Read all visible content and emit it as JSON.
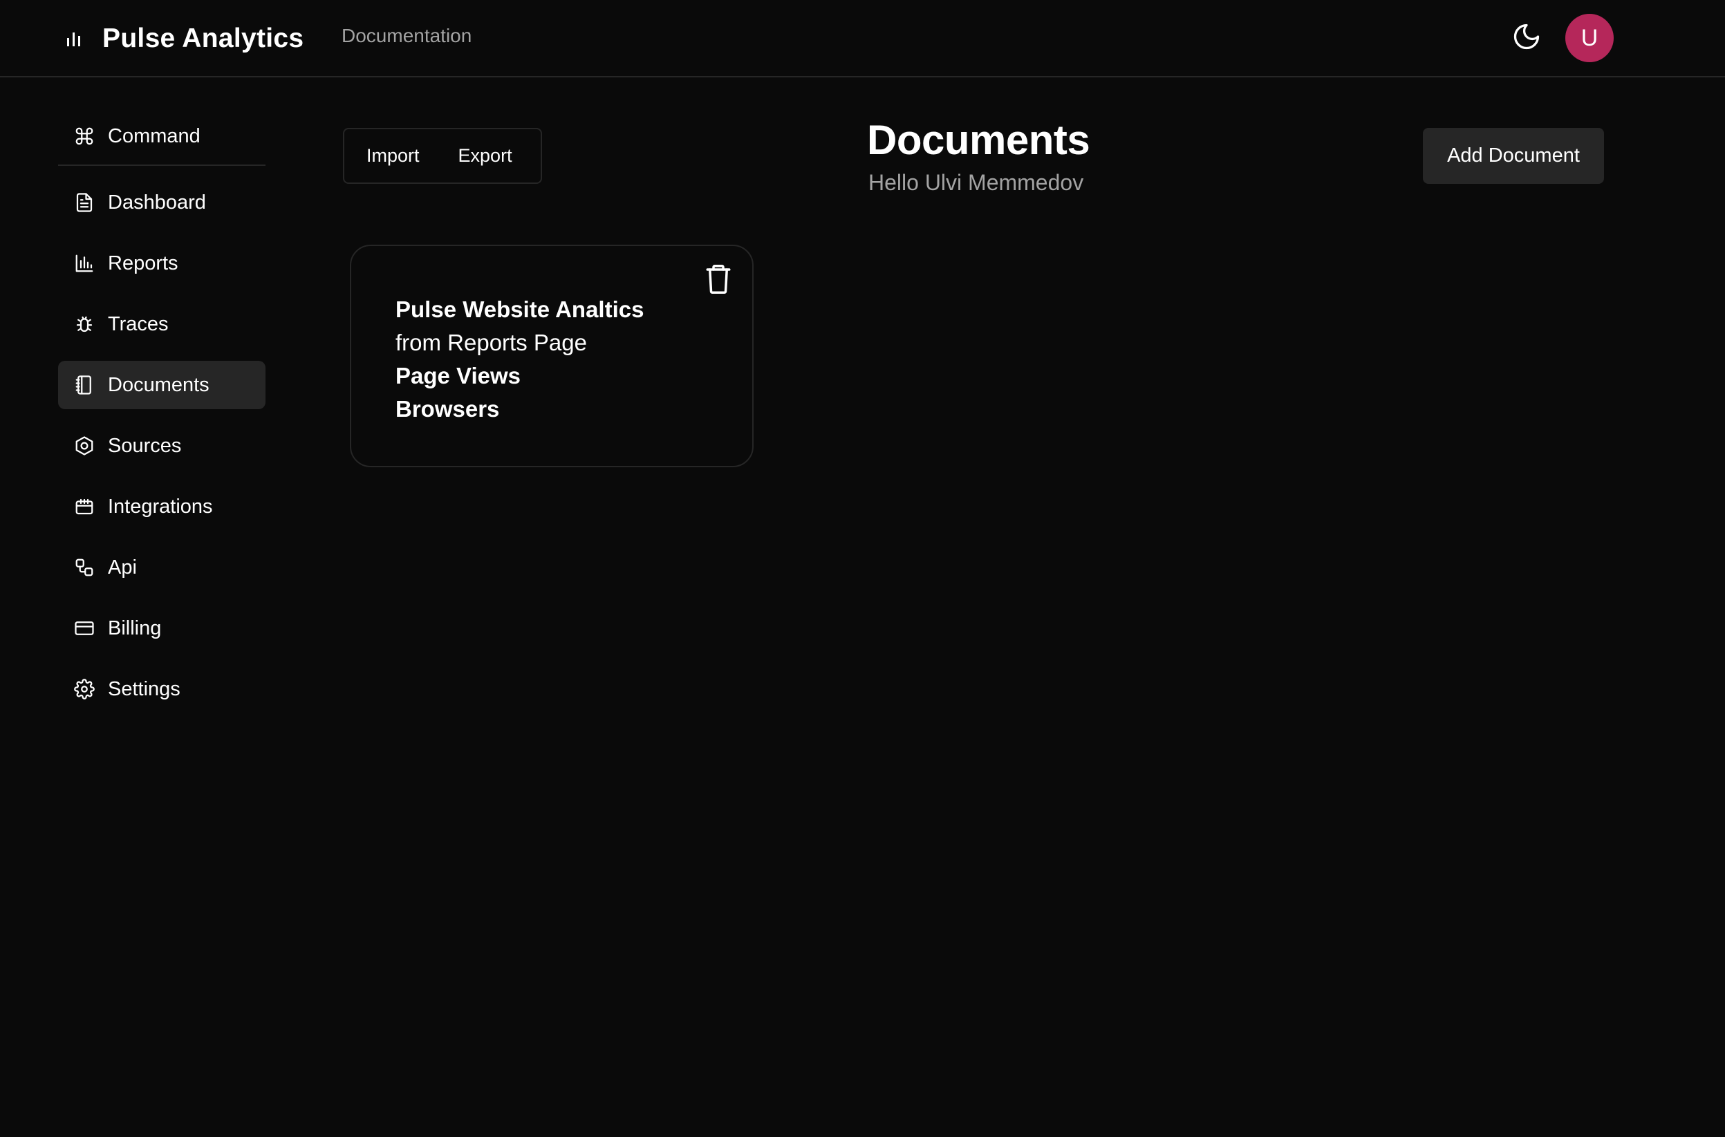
{
  "header": {
    "brand": "Pulse Analytics",
    "documentation_link": "Documentation",
    "avatar_initial": "U"
  },
  "sidebar": {
    "items": [
      {
        "label": "Command",
        "icon": "command-icon"
      },
      {
        "label": "Dashboard",
        "icon": "file-icon"
      },
      {
        "label": "Reports",
        "icon": "bar-chart-icon"
      },
      {
        "label": "Traces",
        "icon": "bug-icon"
      },
      {
        "label": "Documents",
        "icon": "notebook-icon",
        "active": true
      },
      {
        "label": "Sources",
        "icon": "hexagon-icon"
      },
      {
        "label": "Integrations",
        "icon": "calendar-icon"
      },
      {
        "label": "Api",
        "icon": "workflow-icon"
      },
      {
        "label": "Billing",
        "icon": "credit-card-icon"
      },
      {
        "label": "Settings",
        "icon": "gear-icon"
      }
    ]
  },
  "toolbar": {
    "import_label": "Import",
    "export_label": "Export",
    "add_label": "Add Document"
  },
  "main": {
    "title": "Documents",
    "subtitle": "Hello Ulvi Memmedov",
    "documents": [
      {
        "name": "Pulse Website Analtics",
        "source": "from Reports Page",
        "reports": [
          "Page Views",
          "Browsers"
        ]
      }
    ]
  },
  "colors": {
    "background": "#0a0a0a",
    "border": "#262626",
    "muted_text": "#a3a3a3",
    "avatar": "#b5275a"
  }
}
